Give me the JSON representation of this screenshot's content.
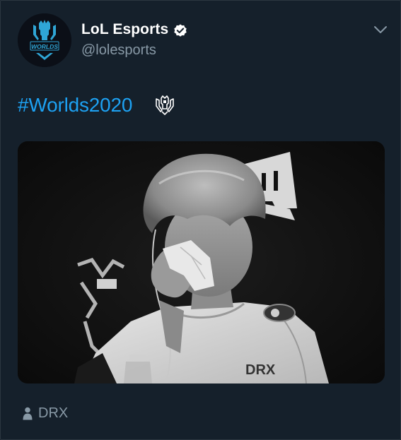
{
  "tweet": {
    "author": {
      "display_name": "LoL Esports",
      "handle": "@lolesports",
      "verified": true,
      "avatar_text": "WORLDS"
    },
    "text": "#Worlds2020",
    "hashtag_emoji": "worlds-trophy-emoji",
    "media": {
      "type": "photo",
      "description_icon": "photo",
      "jersey_text": "DRX"
    },
    "tagged_user_icon": "person-icon",
    "tagged_user": "DRX"
  },
  "colors": {
    "background": "#15202b",
    "link": "#1da1f2",
    "secondary_text": "#8899a6",
    "primary_text": "#ffffff"
  }
}
